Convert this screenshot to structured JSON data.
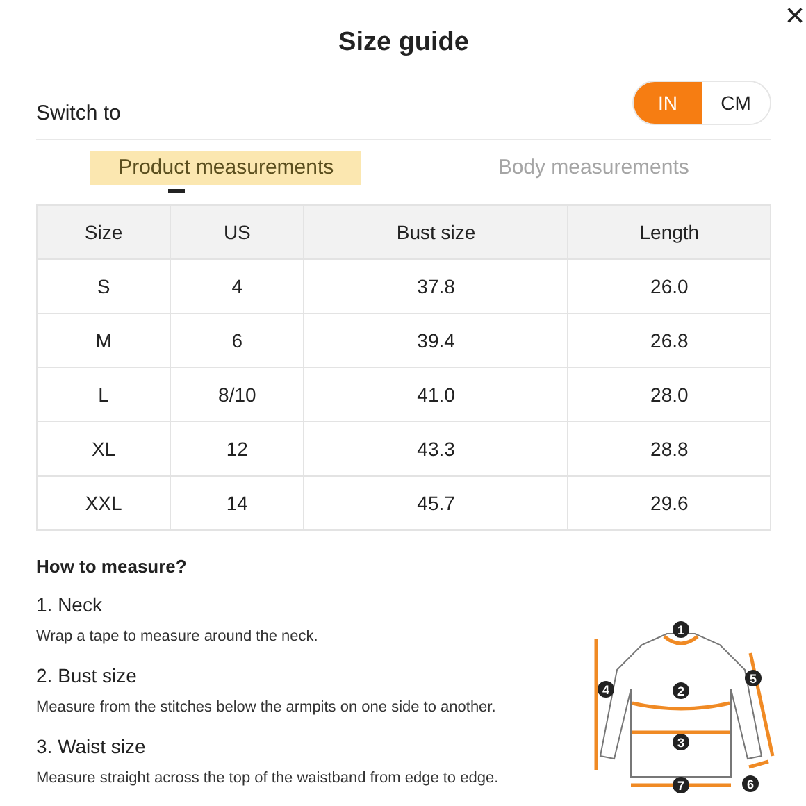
{
  "close": "×",
  "title": "Size guide",
  "unit_switch": {
    "label": "Switch to",
    "options": [
      {
        "label": "IN",
        "selected": true
      },
      {
        "label": "CM",
        "selected": false
      }
    ]
  },
  "tabs": [
    {
      "label": "Product measurements",
      "selected": true
    },
    {
      "label": "Body measurements",
      "selected": false
    }
  ],
  "table": {
    "columns": [
      "Size",
      "US",
      "Bust size",
      "Length"
    ],
    "rows": [
      [
        "S",
        "4",
        "37.8",
        "26.0"
      ],
      [
        "M",
        "6",
        "39.4",
        "26.8"
      ],
      [
        "L",
        "8/10",
        "41.0",
        "28.0"
      ],
      [
        "XL",
        "12",
        "43.3",
        "28.8"
      ],
      [
        "XXL",
        "14",
        "45.7",
        "29.6"
      ]
    ]
  },
  "how_to_measure": {
    "heading": "How to measure?",
    "steps": [
      {
        "title": "1. Neck",
        "text": "Wrap a tape to measure around the neck."
      },
      {
        "title": "2. Bust size",
        "text": "Measure from the stitches below the armpits on one side to another."
      },
      {
        "title": "3. Waist size",
        "text": "Measure straight across the top of the waistband from edge to edge."
      }
    ],
    "diagram_markers": [
      "1",
      "2",
      "3",
      "4",
      "5",
      "6",
      "7"
    ]
  }
}
